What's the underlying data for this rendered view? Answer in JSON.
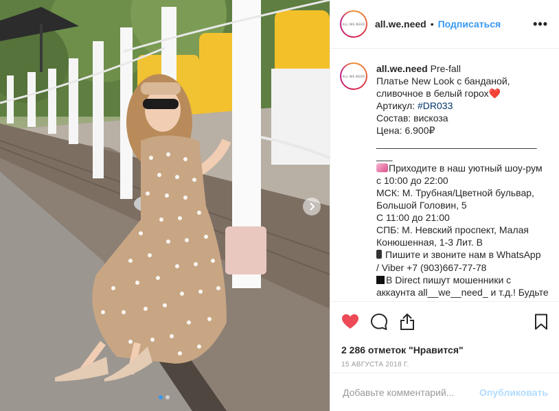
{
  "post": {
    "username": "all.we.need",
    "separator": "•",
    "follow_label": "Подписаться",
    "more_label": "•••",
    "avatar_text": "ALL.WE.NEED"
  },
  "caption": {
    "username": "all.we.need",
    "line1": " Pre-fall",
    "line2": "Платье New Look с банданой,",
    "line3": "сливочное в белый горох",
    "heart": "❤️",
    "line4_prefix": "Артикул: ",
    "hashtag": "#DR033",
    "line5": "Состав: вискоза",
    "line6": "Цена: 6.900₽",
    "line7": "______________________________",
    "line8": "___",
    "line9": "Приходите в наш уютный шоу-рум",
    "line10": "с 10:00 до 22:00",
    "line11": "МСК: М. Трубная/Цветной бульвар,",
    "line12": "Большой Головин, 5",
    "line13": "С 11:00 до 21:00",
    "line14": "СПБ: М. Невский проспект, Малая",
    "line15": "Конюшенная, 1-3 Лит. В",
    "line16": "Пишите и звоните нам в WhatsApp",
    "line17": "/ Viber +7 (903)667-77-78",
    "line18": "В Direct пишут мошенники с",
    "line19": "аккаунта all__we__need_ и т.д.! Будьте"
  },
  "actions": {
    "like_icon": "heart-filled-icon",
    "comment_icon": "comment-bubble-icon",
    "share_icon": "share-upload-icon",
    "save_icon": "bookmark-icon"
  },
  "likes_text": "2 286 отметок \"Нравится\"",
  "date_text": "15 августа 2018 г.",
  "comment": {
    "placeholder": "Добавьте комментарий...",
    "publish_label": "Опубликовать"
  },
  "carousel": {
    "total": 2,
    "active": 1
  },
  "colors": {
    "accent": "#3897f0",
    "like_red": "#ed4956",
    "publish_disabled": "#b3dbff",
    "hashtag": "#003569"
  }
}
